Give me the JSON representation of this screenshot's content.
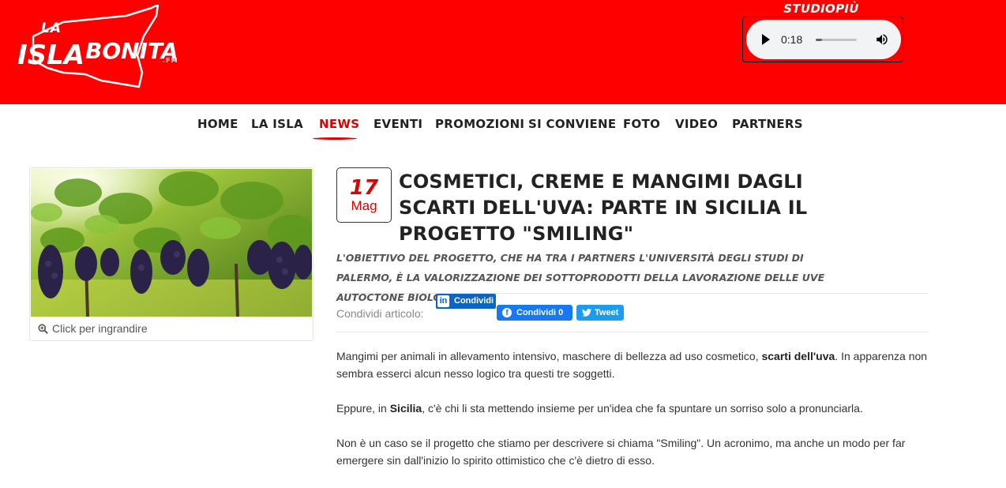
{
  "header": {
    "logo": {
      "line1": "LA",
      "line2_a": "ISLA",
      "line2_b": "BONITA",
      "suffix": ".FM"
    },
    "radio_title": "STUDIOPIÙ SICILIA",
    "player": {
      "time": "0:18",
      "progress": 0.15,
      "play_icon": "play-icon",
      "volume_icon": "volume-icon"
    },
    "background_color": "#fe0000"
  },
  "nav": {
    "items": [
      {
        "label": "HOME",
        "active": false
      },
      {
        "label": "LA ISLA",
        "active": false
      },
      {
        "label": "NEWS",
        "active": true
      },
      {
        "label": "EVENTI",
        "active": false
      },
      {
        "label": "PROMOZIONI",
        "active": false
      },
      {
        "label": "SI CONVIENE",
        "active": false
      },
      {
        "label": "FOTO",
        "active": false
      },
      {
        "label": "VIDEO",
        "active": false
      },
      {
        "label": "PARTNERS",
        "active": false
      }
    ],
    "active_color": "#e00000"
  },
  "image_card": {
    "enlarge_label": "Click per ingrandire",
    "enlarge_icon": "zoom-in-icon"
  },
  "article": {
    "date": {
      "day": "17",
      "month": "Mag"
    },
    "title": "COSMETICI, CREME E MANGIMI DAGLI SCARTI DELL'UVA: PARTE IN SICILIA IL PROGETTO \"SMILING\"",
    "subtitle": "L'OBIETTIVO DEL PROGETTO, CHE HA TRA I PARTNERS L'UNIVERSITÀ DEGLI STUDI DI PALERMO, È LA VALORIZZAZIONE DEI SOTTOPRODOTTI DELLA LAVORAZIONE DELLE UVE AUTOCTONE BIOLOGICHE",
    "share": {
      "label": "Condividi articolo:",
      "linkedin": "Condividi",
      "facebook": "Condividi 0",
      "twitter": "Tweet"
    },
    "paragraphs": [
      {
        "a": "Mangimi per animali in allevamento intensivo, maschere di bellezza ad uso cosmetico, ",
        "strong": "scarti dell'uva",
        "b": ". In apparenza non sembra esserci alcun nesso logico tra questi tre soggetti."
      },
      {
        "a": "Eppure, in ",
        "strong": "Sicilia",
        "b": ", c'è chi li sta mettendo insieme per un'idea che fa spuntare un sorriso solo a pronunciarla."
      },
      {
        "a": "Non è un caso se il progetto che stiamo per descrivere si chiama \"Smiling\". Un acronimo, ma anche un modo per far emergere sin dall'inizio lo spirito ottimistico che c'è dietro di esso.",
        "strong": "",
        "b": ""
      }
    ]
  }
}
